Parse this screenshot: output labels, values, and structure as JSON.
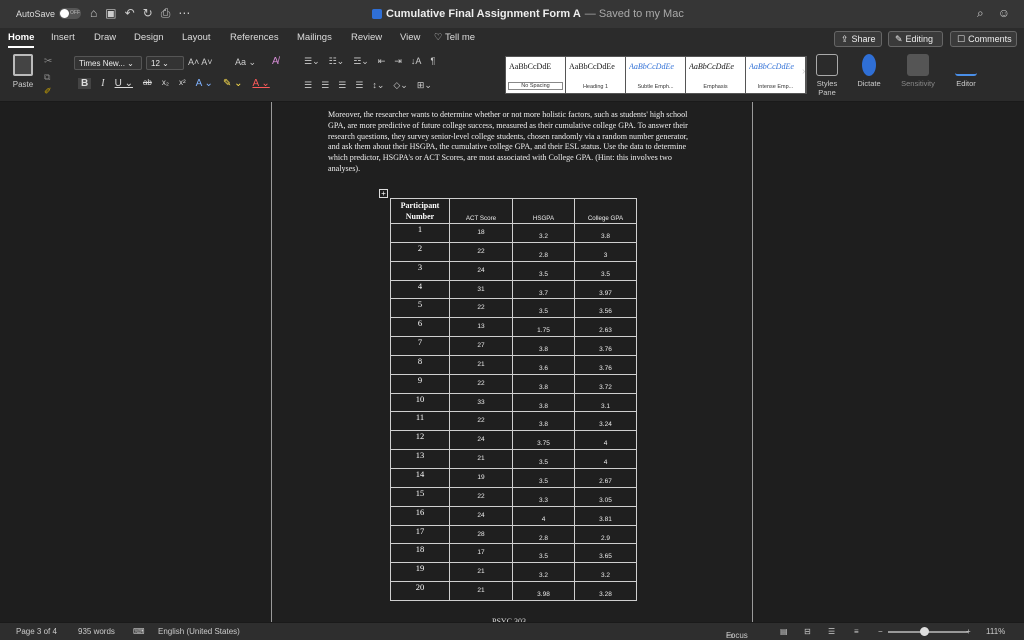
{
  "titlebar": {
    "autosave_label": "AutoSave",
    "autosave_state": "OFF",
    "doc_title": "Cumulative Final Assignment Form A",
    "saved_status": "— Saved to my Mac"
  },
  "tabs": [
    "Home",
    "Insert",
    "Draw",
    "Design",
    "Layout",
    "References",
    "Mailings",
    "Review",
    "View"
  ],
  "tell_me": "Tell me",
  "buttons": {
    "share": "Share",
    "editing": "Editing",
    "comments": "Comments"
  },
  "ribbon": {
    "paste": "Paste",
    "font_name": "Times New...",
    "font_size": "12",
    "styles": [
      {
        "sample": "AaBbCcDdE",
        "name": "No Spacing"
      },
      {
        "sample": "AaBbCcDdEe",
        "name": "Heading 1"
      },
      {
        "sample": "AaBbCcDdEe",
        "name": "Subtle Emph..."
      },
      {
        "sample": "AaBbCcDdEe",
        "name": "Emphasis"
      },
      {
        "sample": "AaBbCcDdEe",
        "name": "Intense Emp..."
      }
    ],
    "styles_pane": "Styles Pane",
    "dictate": "Dictate",
    "sensitivity": "Sensitivity",
    "editor": "Editor"
  },
  "document": {
    "paragraph": "Moreover, the researcher wants to determine whether or not more holistic factors, such as students' high school GPA, are more predictive of future college success, measured as their cumulative college GPA. To answer their research questions, they survey senior-level college students, chosen randomly via a random number generator, and ask them about their HSGPA, the cumulative college GPA, and their ESL status. Use the data to determine which predictor, HSGPA's or ACT Scores, are most associated with College GPA. (Hint: this involves two analyses).",
    "table_headers": [
      "Participant Number",
      "ACT Score",
      "HSGPA",
      "College GPA"
    ],
    "table_rows": [
      [
        "1",
        "18",
        "3.2",
        "3.8"
      ],
      [
        "2",
        "22",
        "2.8",
        "3"
      ],
      [
        "3",
        "24",
        "3.5",
        "3.5"
      ],
      [
        "4",
        "31",
        "3.7",
        "3.97"
      ],
      [
        "5",
        "22",
        "3.5",
        "3.56"
      ],
      [
        "6",
        "13",
        "1.75",
        "2.63"
      ],
      [
        "7",
        "27",
        "3.8",
        "3.76"
      ],
      [
        "8",
        "21",
        "3.6",
        "3.76"
      ],
      [
        "9",
        "22",
        "3.8",
        "3.72"
      ],
      [
        "10",
        "33",
        "3.8",
        "3.1"
      ],
      [
        "11",
        "22",
        "3.8",
        "3.24"
      ],
      [
        "12",
        "24",
        "3.75",
        "4"
      ],
      [
        "13",
        "21",
        "3.5",
        "4"
      ],
      [
        "14",
        "19",
        "3.5",
        "2.67"
      ],
      [
        "15",
        "22",
        "3.3",
        "3.05"
      ],
      [
        "16",
        "24",
        "4",
        "3.81"
      ],
      [
        "17",
        "28",
        "2.8",
        "2.9"
      ],
      [
        "18",
        "17",
        "3.5",
        "3.65"
      ],
      [
        "19",
        "21",
        "3.2",
        "3.2"
      ],
      [
        "20",
        "21",
        "3.98",
        "3.28"
      ]
    ],
    "footer_text": "PSYC 303"
  },
  "statusbar": {
    "page": "Page 3 of 4",
    "words": "935 words",
    "language": "English (United States)",
    "focus": "Focus",
    "zoom": "111%",
    "zoom_fraction": 0.45
  }
}
